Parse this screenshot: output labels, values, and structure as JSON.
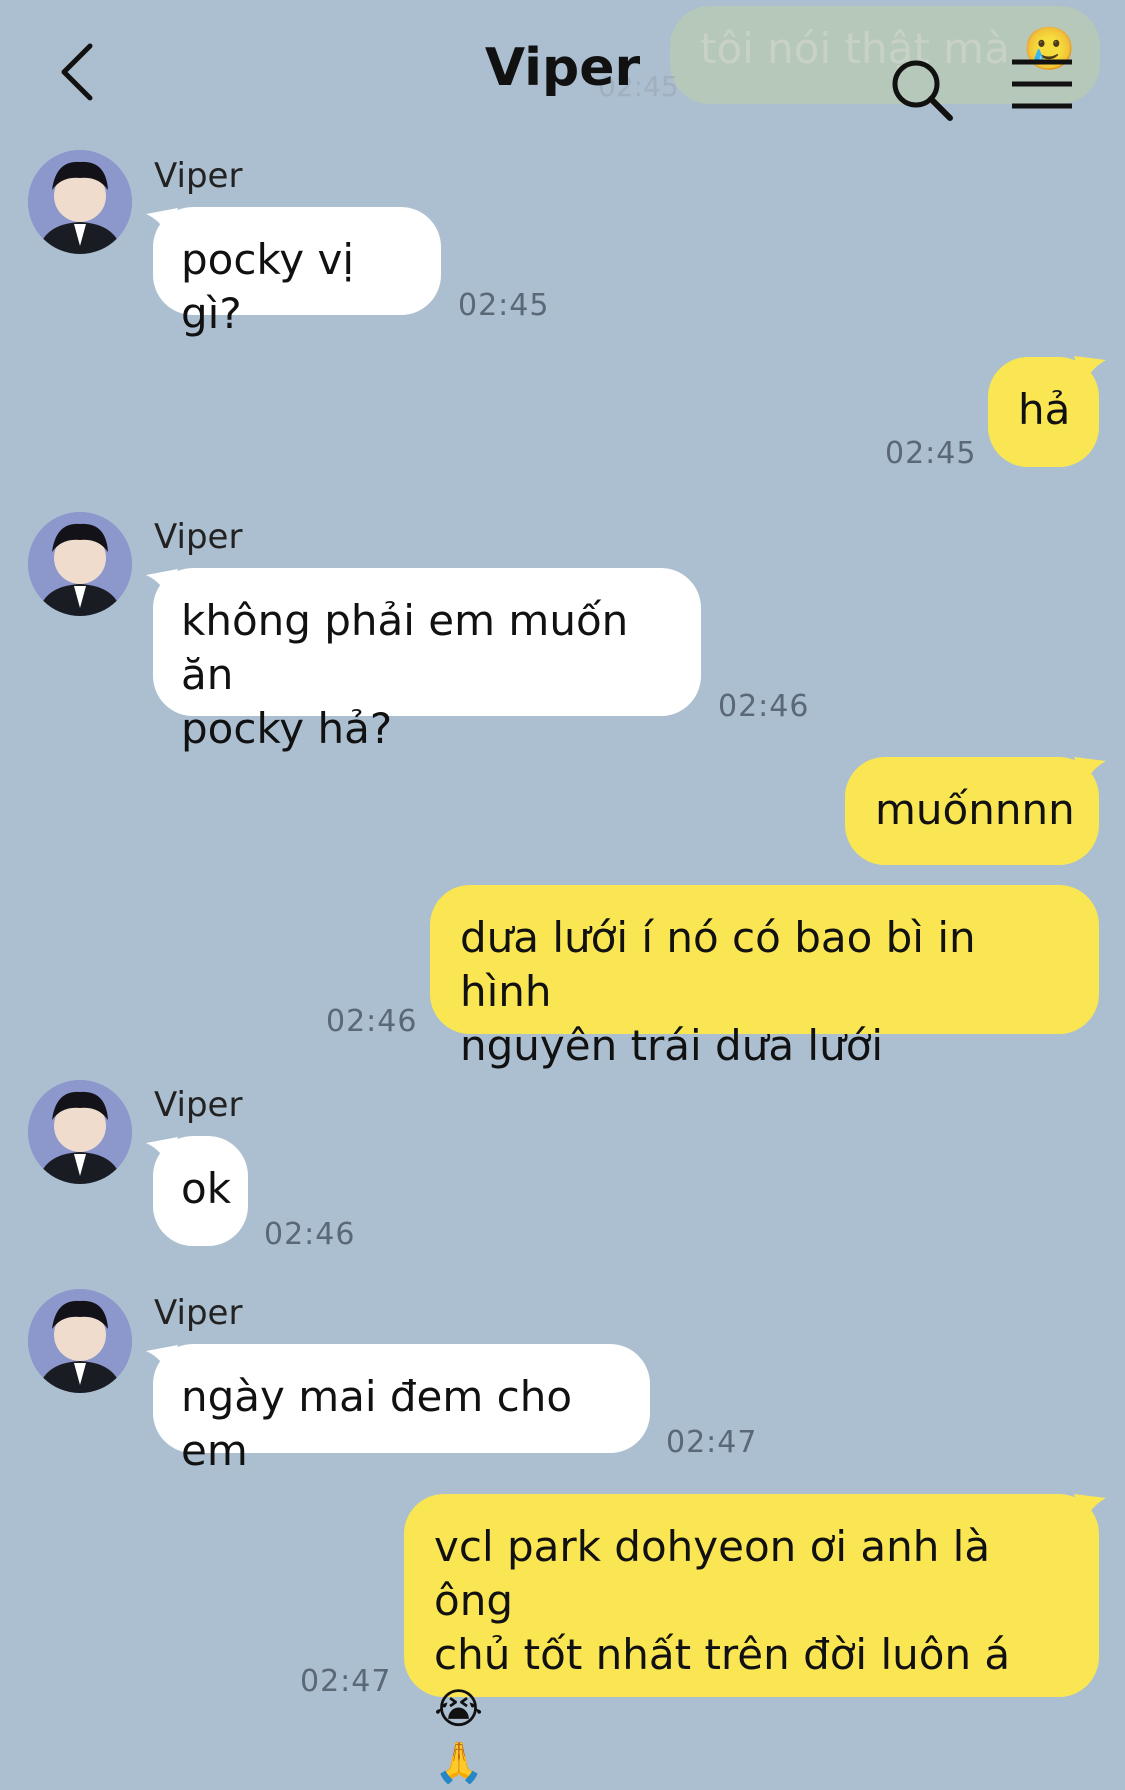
{
  "header": {
    "title": "Viper",
    "ghost_text": "tôi nói thật mà 🥲",
    "ghost_time": "02:45"
  },
  "messages": [
    {
      "dir": "in",
      "sender": "Viper",
      "lines": [
        "pocky vị gì?"
      ],
      "time": "02:45"
    },
    {
      "dir": "out",
      "lines": [
        "hả"
      ],
      "time": "02:45"
    },
    {
      "dir": "in",
      "sender": "Viper",
      "lines": [
        "không phải em muốn ăn",
        "pocky hả?"
      ],
      "time": "02:46"
    },
    {
      "dir": "out",
      "lines": [
        "muốnnnn"
      ],
      "time": ""
    },
    {
      "dir": "out",
      "lines": [
        "dưa lưới í nó có bao bì in hình",
        "nguyên trái dưa lưới"
      ],
      "time": "02:46"
    },
    {
      "dir": "in",
      "sender": "Viper",
      "lines": [
        "ok"
      ],
      "time": "02:46"
    },
    {
      "dir": "in",
      "sender": "Viper",
      "lines": [
        "ngày mai đem cho em"
      ],
      "time": "02:47"
    },
    {
      "dir": "out",
      "lines": [
        "vcl park dohyeon ơi anh là ông",
        "chủ tốt nhất trên đời luôn á 😭",
        "🙏"
      ],
      "time": "02:47"
    }
  ],
  "colors": {
    "background": "#acbfd0",
    "bubble_in": "#ffffff",
    "bubble_out": "#fae652"
  },
  "icons": {
    "back": "chevron-left-icon",
    "search": "search-icon",
    "menu": "hamburger-menu-icon",
    "avatar": "avatar"
  }
}
